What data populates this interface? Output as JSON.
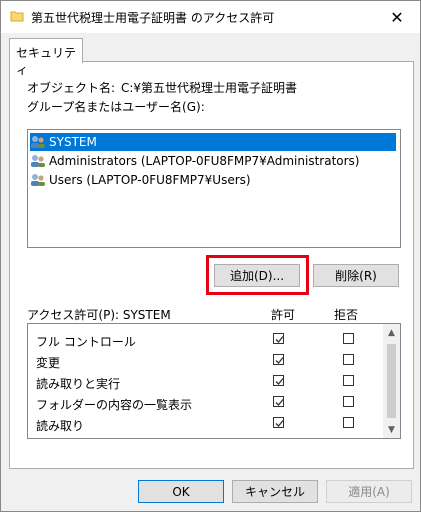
{
  "window": {
    "title": "第五世代税理士用電子証明書 のアクセス許可",
    "close_glyph": "✕"
  },
  "tabs": [
    {
      "label": "セキュリティ"
    }
  ],
  "object": {
    "label": "オブジェクト名:",
    "value": "C:¥第五世代税理士用電子証明書"
  },
  "group_label": "グループ名またはユーザー名(G):",
  "principals": [
    {
      "name": "SYSTEM",
      "selected": true
    },
    {
      "name": "Administrators (LAPTOP-0FU8FMP7¥Administrators)",
      "selected": false
    },
    {
      "name": "Users (LAPTOP-0FU8FMP7¥Users)",
      "selected": false
    }
  ],
  "buttons": {
    "add": "追加(D)...",
    "remove": "削除(R)"
  },
  "permissions": {
    "label": "アクセス許可(P): SYSTEM",
    "allow_header": "許可",
    "deny_header": "拒否",
    "rows": [
      {
        "name": "フル コントロール",
        "allow": true,
        "deny": false
      },
      {
        "name": "変更",
        "allow": true,
        "deny": false
      },
      {
        "name": "読み取りと実行",
        "allow": true,
        "deny": false
      },
      {
        "name": "フォルダーの内容の一覧表示",
        "allow": true,
        "deny": false
      },
      {
        "name": "読み取り",
        "allow": true,
        "deny": false
      }
    ]
  },
  "footer": {
    "ok": "OK",
    "cancel": "キャンセル",
    "apply": "適用(A)"
  },
  "colors": {
    "selection": "#0078d7",
    "highlight_box": "#e60012"
  }
}
